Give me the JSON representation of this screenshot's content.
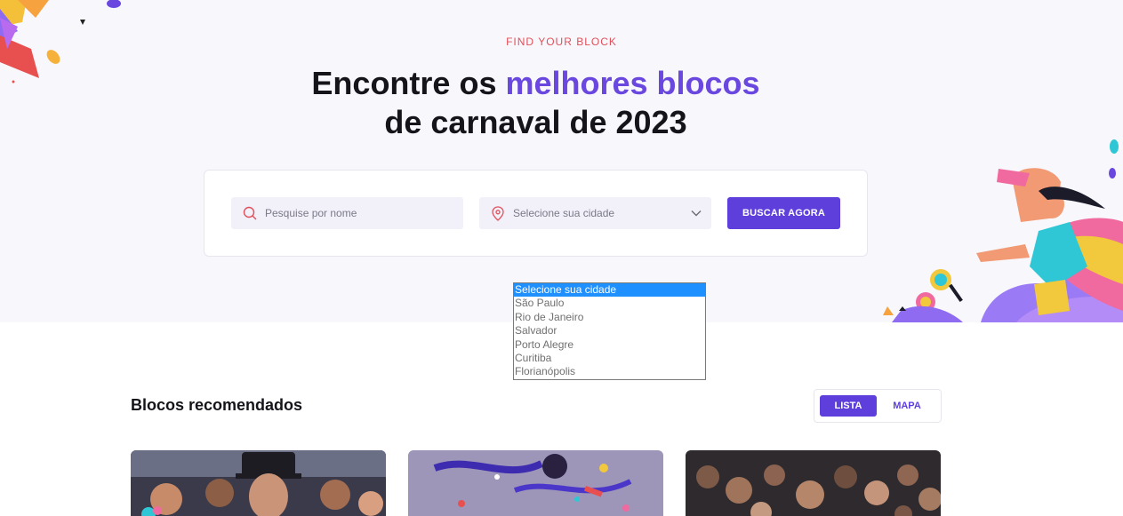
{
  "hero": {
    "eyebrow": "FIND YOUR BLOCK",
    "headline_part1": "Encontre os ",
    "headline_accent": "melhores blocos",
    "headline_line2": "de carnaval de 2023"
  },
  "search": {
    "name_placeholder": "Pesquise por nome",
    "city_placeholder": "Selecione sua cidade",
    "button_label": "BUSCAR AGORA"
  },
  "city_dropdown": {
    "options": [
      "Selecione sua cidade",
      "São Paulo",
      "Rio de Janeiro",
      "Salvador",
      "Porto Alegre",
      "Curitiba",
      "Florianópolis"
    ],
    "selected_index": 0
  },
  "recommended": {
    "title": "Blocos recomendados",
    "view_list": "LISTA",
    "view_map": "MAPA"
  },
  "colors": {
    "brand": "#5e3fdc",
    "accent_text": "#6a48e0",
    "eyebrow": "#e0505a",
    "hero_bg": "#f7f7fc"
  },
  "icons": [
    "search-icon",
    "location-pin-icon",
    "chevron-down-icon"
  ]
}
